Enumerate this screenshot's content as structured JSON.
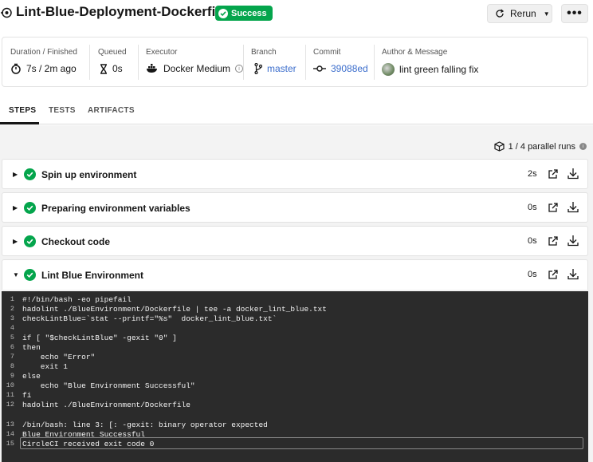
{
  "header": {
    "job_title": "Lint-Blue-Deployment-Dockerfile",
    "status_badge": "Success",
    "rerun_label": "Rerun",
    "more_label": "•••"
  },
  "summary": {
    "duration_label": "Duration / Finished",
    "duration_value": "7s / 2m ago",
    "queued_label": "Queued",
    "queued_value": "0s",
    "executor_label": "Executor",
    "executor_value": "Docker Medium",
    "branch_label": "Branch",
    "branch_value": "master",
    "commit_label": "Commit",
    "commit_value": "39088ed",
    "author_label": "Author & Message",
    "author_message": "lint green falling fix"
  },
  "tabs": [
    {
      "label": "STEPS",
      "active": true
    },
    {
      "label": "TESTS",
      "active": false
    },
    {
      "label": "ARTIFACTS",
      "active": false
    }
  ],
  "parallel_runs": "1 / 4 parallel runs",
  "steps": [
    {
      "name": "Spin up environment",
      "duration": "2s",
      "expanded": false
    },
    {
      "name": "Preparing environment variables",
      "duration": "0s",
      "expanded": false
    },
    {
      "name": "Checkout code",
      "duration": "0s",
      "expanded": false
    },
    {
      "name": "Lint Blue Environment",
      "duration": "0s",
      "expanded": true
    }
  ],
  "script_lines": [
    {
      "n": "1",
      "text": "#!/bin/bash -eo pipefail"
    },
    {
      "n": "2",
      "text": "hadolint ./BlueEnvironment/Dockerfile | tee -a docker_lint_blue.txt"
    },
    {
      "n": "3",
      "text": "checkLintBlue=`stat --printf=\"%s\"  docker_lint_blue.txt`"
    },
    {
      "n": "4",
      "text": ""
    },
    {
      "n": "5",
      "text": "if [ \"$checkLintBlue\" -gexit \"0\" ]"
    },
    {
      "n": "6",
      "text": "then"
    },
    {
      "n": "7",
      "text": "    echo \"Error\""
    },
    {
      "n": "8",
      "text": "    exit 1"
    },
    {
      "n": "9",
      "text": "else"
    },
    {
      "n": "10",
      "text": "    echo \"Blue Environment Successful\""
    },
    {
      "n": "11",
      "text": "fi"
    },
    {
      "n": "12",
      "text": "hadolint ./BlueEnvironment/Dockerfile"
    }
  ],
  "output_lines": [
    {
      "n": "13",
      "text": "/bin/bash: line 3: [: -gexit: binary operator expected"
    },
    {
      "n": "14",
      "text": "Blue Environment Successful"
    },
    {
      "n": "15",
      "text": "CircleCI received exit code 0"
    }
  ],
  "colors": {
    "success_green": "#04a54c",
    "link_blue": "#3b6dcc",
    "terminal_bg": "#2b2b2b"
  },
  "icons": {
    "job": "job-icon",
    "duration": "stopwatch-icon",
    "queued": "hourglass-icon",
    "executor": "docker-icon",
    "branch": "branch-icon",
    "commit": "commit-icon",
    "parallel": "cube-icon",
    "step_open": "external-link-icon",
    "step_download": "download-icon"
  }
}
